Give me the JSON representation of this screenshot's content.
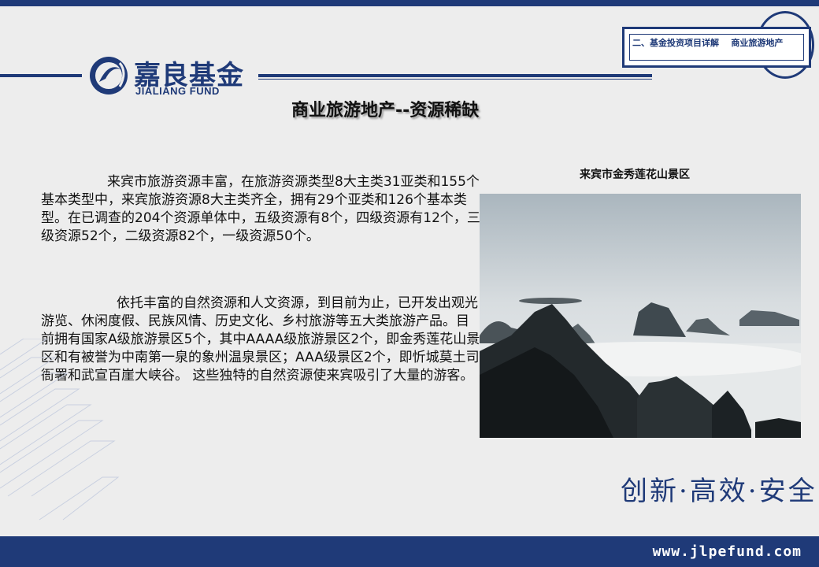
{
  "colors": {
    "brand": "#1f3a78",
    "background": "#ededed"
  },
  "header": {
    "logo_cn": "嘉良基金",
    "logo_en": "JIALIANG FUND",
    "section_tag": "二、基金投资项目详解    商业旅游地产"
  },
  "main": {
    "title": "商业旅游地产--资源稀缺",
    "paragraph1": "来宾市旅游资源丰富，在旅游资源类型8大主类31亚类和155个基本类型中，来宾旅游资源8大主类齐全，拥有29个亚类和126个基本类型。在已调查的204个资源单体中，五级资源有8个，四级资源有12个，三级资源52个，二级资源82个，一级资源50个。",
    "paragraph2": "依托丰富的自然资源和人文资源，到目前为止，已开发出观光游览、休闲度假、民族风情、历史文化、乡村旅游等五大类旅游产品。目前拥有国家A级旅游景区5个，其中AAAA级旅游景区2个，即金秀莲花山景区和有被誉为中南第一泉的象州温泉景区；AAA级景区2个，即忻城莫土司衙署和武宣百崖大峡谷。 这些独特的自然资源使来宾吸引了大量的游客。",
    "photo_caption": "来宾市金秀莲花山景区"
  },
  "footer": {
    "slogan": "创新·高效·安全",
    "website": "www.jlpefund.com"
  }
}
